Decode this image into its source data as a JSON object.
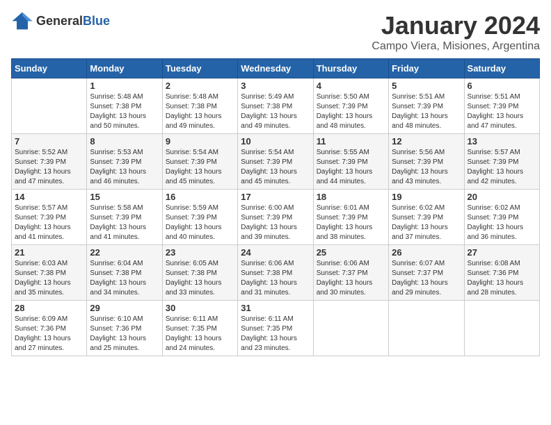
{
  "logo": {
    "general": "General",
    "blue": "Blue"
  },
  "header": {
    "title": "January 2024",
    "subtitle": "Campo Viera, Misiones, Argentina"
  },
  "weekdays": [
    "Sunday",
    "Monday",
    "Tuesday",
    "Wednesday",
    "Thursday",
    "Friday",
    "Saturday"
  ],
  "weeks": [
    [
      {
        "day": "",
        "info": ""
      },
      {
        "day": "1",
        "info": "Sunrise: 5:48 AM\nSunset: 7:38 PM\nDaylight: 13 hours\nand 50 minutes."
      },
      {
        "day": "2",
        "info": "Sunrise: 5:48 AM\nSunset: 7:38 PM\nDaylight: 13 hours\nand 49 minutes."
      },
      {
        "day": "3",
        "info": "Sunrise: 5:49 AM\nSunset: 7:38 PM\nDaylight: 13 hours\nand 49 minutes."
      },
      {
        "day": "4",
        "info": "Sunrise: 5:50 AM\nSunset: 7:39 PM\nDaylight: 13 hours\nand 48 minutes."
      },
      {
        "day": "5",
        "info": "Sunrise: 5:51 AM\nSunset: 7:39 PM\nDaylight: 13 hours\nand 48 minutes."
      },
      {
        "day": "6",
        "info": "Sunrise: 5:51 AM\nSunset: 7:39 PM\nDaylight: 13 hours\nand 47 minutes."
      }
    ],
    [
      {
        "day": "7",
        "info": "Sunrise: 5:52 AM\nSunset: 7:39 PM\nDaylight: 13 hours\nand 47 minutes."
      },
      {
        "day": "8",
        "info": "Sunrise: 5:53 AM\nSunset: 7:39 PM\nDaylight: 13 hours\nand 46 minutes."
      },
      {
        "day": "9",
        "info": "Sunrise: 5:54 AM\nSunset: 7:39 PM\nDaylight: 13 hours\nand 45 minutes."
      },
      {
        "day": "10",
        "info": "Sunrise: 5:54 AM\nSunset: 7:39 PM\nDaylight: 13 hours\nand 45 minutes."
      },
      {
        "day": "11",
        "info": "Sunrise: 5:55 AM\nSunset: 7:39 PM\nDaylight: 13 hours\nand 44 minutes."
      },
      {
        "day": "12",
        "info": "Sunrise: 5:56 AM\nSunset: 7:39 PM\nDaylight: 13 hours\nand 43 minutes."
      },
      {
        "day": "13",
        "info": "Sunrise: 5:57 AM\nSunset: 7:39 PM\nDaylight: 13 hours\nand 42 minutes."
      }
    ],
    [
      {
        "day": "14",
        "info": "Sunrise: 5:57 AM\nSunset: 7:39 PM\nDaylight: 13 hours\nand 41 minutes."
      },
      {
        "day": "15",
        "info": "Sunrise: 5:58 AM\nSunset: 7:39 PM\nDaylight: 13 hours\nand 41 minutes."
      },
      {
        "day": "16",
        "info": "Sunrise: 5:59 AM\nSunset: 7:39 PM\nDaylight: 13 hours\nand 40 minutes."
      },
      {
        "day": "17",
        "info": "Sunrise: 6:00 AM\nSunset: 7:39 PM\nDaylight: 13 hours\nand 39 minutes."
      },
      {
        "day": "18",
        "info": "Sunrise: 6:01 AM\nSunset: 7:39 PM\nDaylight: 13 hours\nand 38 minutes."
      },
      {
        "day": "19",
        "info": "Sunrise: 6:02 AM\nSunset: 7:39 PM\nDaylight: 13 hours\nand 37 minutes."
      },
      {
        "day": "20",
        "info": "Sunrise: 6:02 AM\nSunset: 7:39 PM\nDaylight: 13 hours\nand 36 minutes."
      }
    ],
    [
      {
        "day": "21",
        "info": "Sunrise: 6:03 AM\nSunset: 7:38 PM\nDaylight: 13 hours\nand 35 minutes."
      },
      {
        "day": "22",
        "info": "Sunrise: 6:04 AM\nSunset: 7:38 PM\nDaylight: 13 hours\nand 34 minutes."
      },
      {
        "day": "23",
        "info": "Sunrise: 6:05 AM\nSunset: 7:38 PM\nDaylight: 13 hours\nand 33 minutes."
      },
      {
        "day": "24",
        "info": "Sunrise: 6:06 AM\nSunset: 7:38 PM\nDaylight: 13 hours\nand 31 minutes."
      },
      {
        "day": "25",
        "info": "Sunrise: 6:06 AM\nSunset: 7:37 PM\nDaylight: 13 hours\nand 30 minutes."
      },
      {
        "day": "26",
        "info": "Sunrise: 6:07 AM\nSunset: 7:37 PM\nDaylight: 13 hours\nand 29 minutes."
      },
      {
        "day": "27",
        "info": "Sunrise: 6:08 AM\nSunset: 7:36 PM\nDaylight: 13 hours\nand 28 minutes."
      }
    ],
    [
      {
        "day": "28",
        "info": "Sunrise: 6:09 AM\nSunset: 7:36 PM\nDaylight: 13 hours\nand 27 minutes."
      },
      {
        "day": "29",
        "info": "Sunrise: 6:10 AM\nSunset: 7:36 PM\nDaylight: 13 hours\nand 25 minutes."
      },
      {
        "day": "30",
        "info": "Sunrise: 6:11 AM\nSunset: 7:35 PM\nDaylight: 13 hours\nand 24 minutes."
      },
      {
        "day": "31",
        "info": "Sunrise: 6:11 AM\nSunset: 7:35 PM\nDaylight: 13 hours\nand 23 minutes."
      },
      {
        "day": "",
        "info": ""
      },
      {
        "day": "",
        "info": ""
      },
      {
        "day": "",
        "info": ""
      }
    ]
  ]
}
